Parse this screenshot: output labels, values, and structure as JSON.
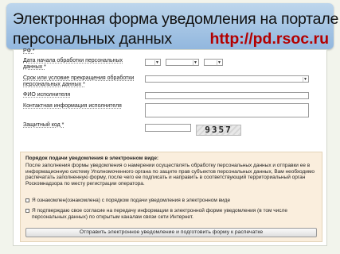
{
  "banner": {
    "title_line1": "Электронная форма уведомления на портале",
    "title_line2": "персональных данных",
    "url": "http://pd.rsoc.ru"
  },
  "form": {
    "fields": {
      "rf_label": "РФ *",
      "start_date_label_1": "Дата начала обработки персональных",
      "start_date_label_2": "данных *",
      "term_label_1": "Срок или условие прекращения обработки",
      "term_label_2": "персональных данных *",
      "executor_name_label": "ФИО исполнителя",
      "executor_contact_label": "Контактная информация исполнителя",
      "captcha_label": "Защитный код *",
      "captcha_code": "9357"
    },
    "notice": {
      "title": "Порядок подачи уведомления в электронном виде:",
      "body": "После заполнения формы уведомления о намерении осуществлять обработку персональных данных и отправки ее в информационную систему Уполномоченного органа по защите прав субъектов персональных данных, Вам необходимо распечатать заполненную форму, после чего ее подписать и направить в соответствующий территориальный орган Роскомнадзора по месту регистрации оператора.",
      "checkbox1": "Я ознакомлен(ознакомлена) с порядком подачи уведомления в электронном виде",
      "checkbox2": "Я подтверждаю свое согласие на передачу информации в электронной форме уведомления (в том числе персональных данных) по открытым каналам связи сети Интернет.",
      "submit_label": "Отправить электронное уведомление и подготовить форму к распечатке"
    }
  }
}
